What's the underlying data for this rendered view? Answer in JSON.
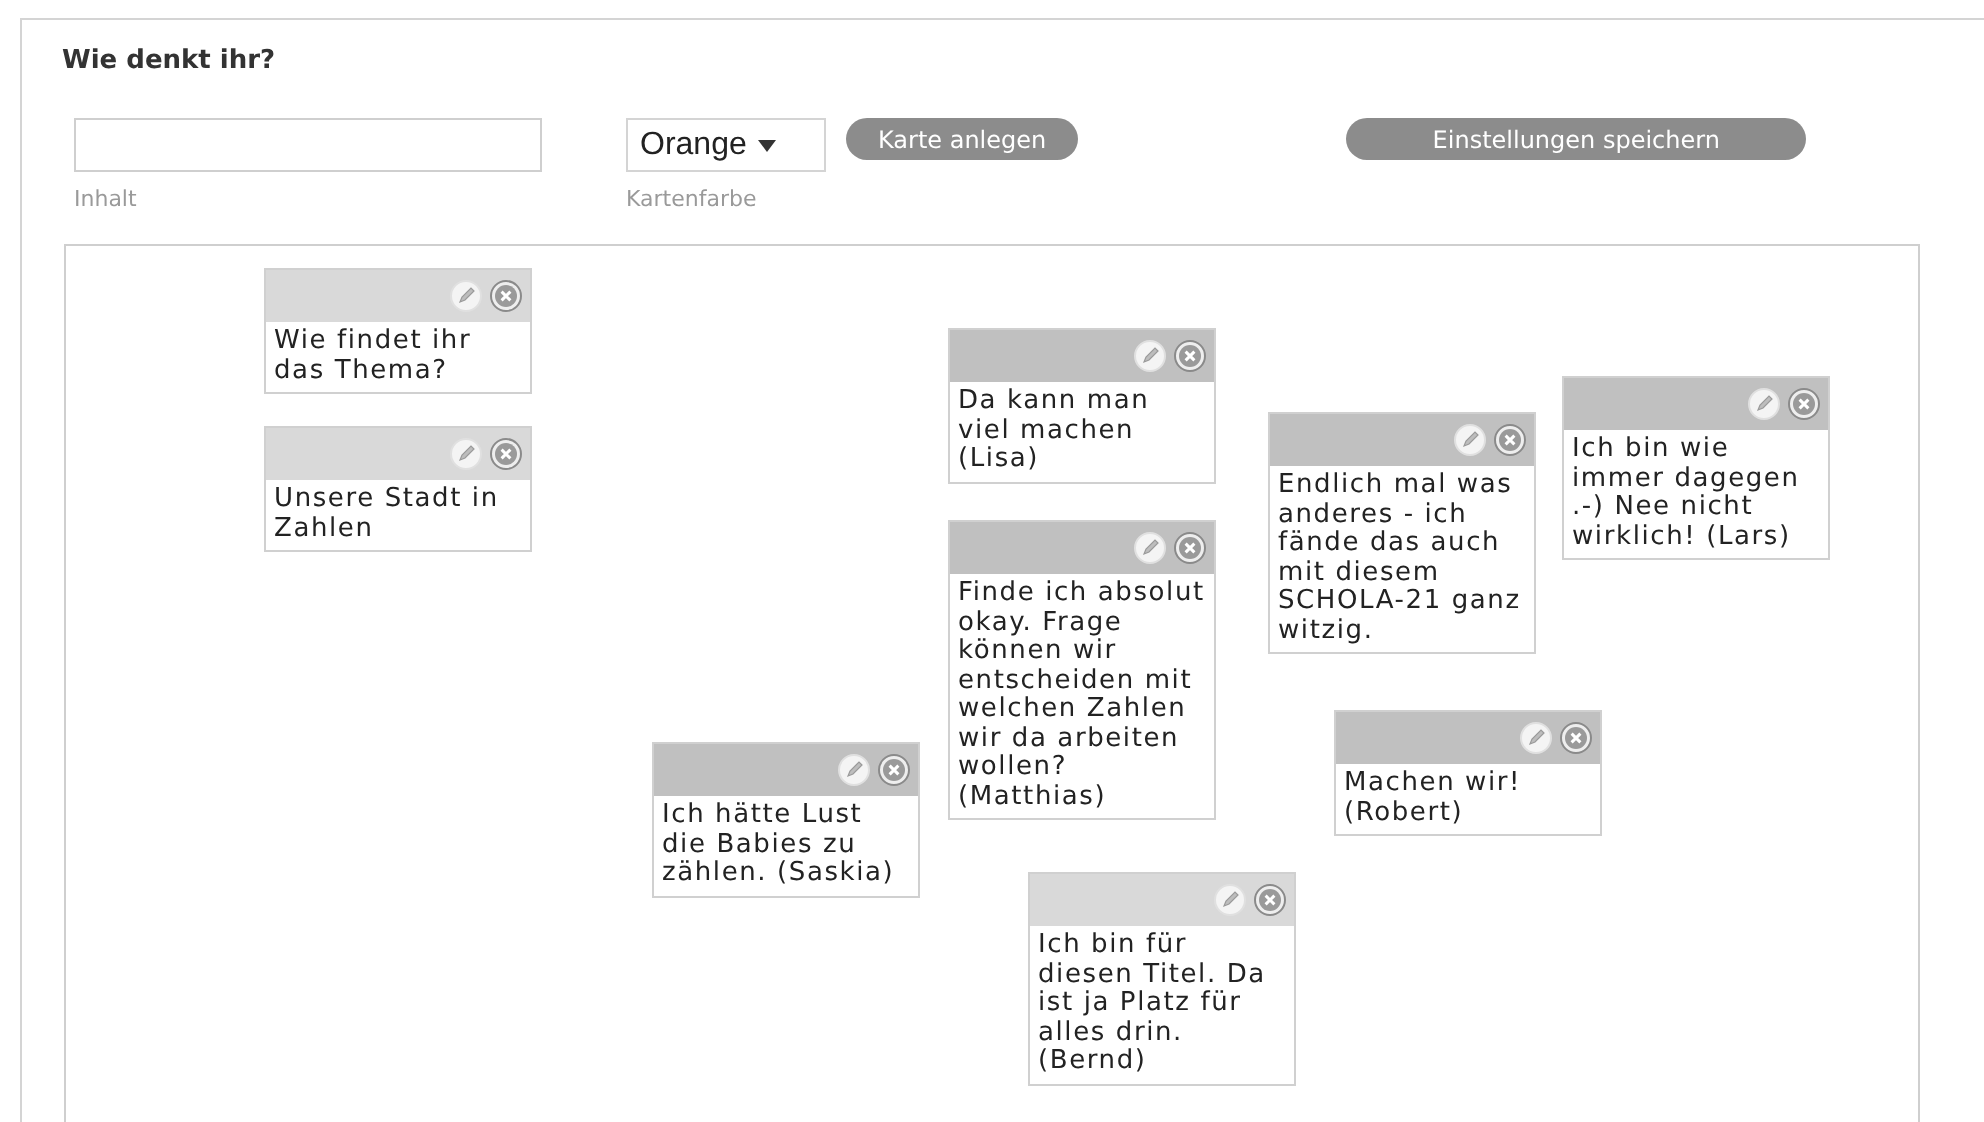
{
  "title": "Wie denkt ihr?",
  "content_field": {
    "label": "Inhalt"
  },
  "color_select": {
    "label": "Kartenfarbe",
    "value": "Orange"
  },
  "create_button": "Karte anlegen",
  "save_button": "Einstellungen speichern",
  "cards": [
    {
      "text": "Wie findet ihr das Thema?",
      "color": "#d9d9d9"
    },
    {
      "text": "Unsere Stadt in Zahlen",
      "color": "#d9d9d9"
    },
    {
      "text": "Da kann man viel machen (Lisa)",
      "color": "#c0c0c0"
    },
    {
      "text": "Finde ich absolut okay. Frage können wir entscheiden mit welchen Zahlen wir da arbeiten wollen? (Matthias)",
      "color": "#c0c0c0"
    },
    {
      "text": "Endlich mal was anderes - ich fände das auch mit diesem SCHOLA-21 ganz witzig.",
      "color": "#c0c0c0"
    },
    {
      "text": "Ich bin wie immer dagegen .-) Nee nicht wirklich! (Lars)",
      "color": "#c0c0c0"
    },
    {
      "text": "Ich hätte Lust die Babies zu zählen. (Saskia)",
      "color": "#c0c0c0"
    },
    {
      "text": "Machen wir! (Robert)",
      "color": "#c0c0c0"
    },
    {
      "text": "Ich bin für diesen Titel. Da ist ja Platz für alles drin. (Bernd)",
      "color": "#d9d9d9"
    }
  ]
}
